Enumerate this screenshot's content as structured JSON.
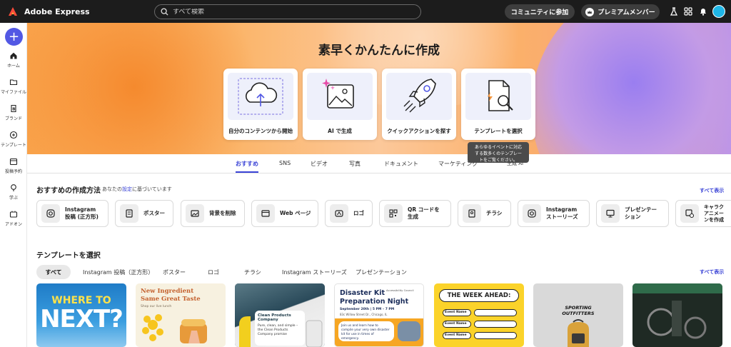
{
  "topbar": {
    "app_title": "Adobe Express",
    "search_placeholder": "すべて検索",
    "community_label": "コミュニティに参加",
    "premium_label": "プレミアムメンバー"
  },
  "sidebar": {
    "items": [
      {
        "label": "ホーム",
        "icon": "home-icon"
      },
      {
        "label": "マイファイル",
        "icon": "folder-icon"
      },
      {
        "label": "ブランド",
        "icon": "brand-icon"
      },
      {
        "label": "テンプレート",
        "icon": "template-icon"
      },
      {
        "label": "投稿予約",
        "icon": "calendar-icon"
      },
      {
        "label": "学ぶ",
        "icon": "learn-icon"
      },
      {
        "label": "アドオン",
        "icon": "addon-icon"
      }
    ]
  },
  "hero": {
    "title": "素早くかんたんに作成",
    "cards": [
      {
        "label": "自分のコンテンツから開始",
        "icon": "upload-cloud-icon"
      },
      {
        "label": "AI で生成",
        "icon": "ai-image-icon"
      },
      {
        "label": "クイックアクションを探す",
        "icon": "rocket-icon"
      },
      {
        "label": "テンプレートを選択",
        "icon": "template-search-icon"
      }
    ],
    "tooltip_line1": "あらゆるイベントに対応",
    "tooltip_line2": "する数多くのテンプレー",
    "tooltip_line3": "トをご覧ください。"
  },
  "tabs": {
    "items": [
      "おすすめ",
      "SNS",
      "ビデオ",
      "写真",
      "ドキュメント",
      "マーケティング"
    ],
    "extra": "生成 AI"
  },
  "recommended": {
    "title": "おすすめの作成方法",
    "subtitle_prefix": "あなたの",
    "subtitle_link": "設定",
    "subtitle_suffix": "に基づいています",
    "see_all": "すべて表示",
    "chips": [
      {
        "label": "Instagram\n投稿 (正方形)",
        "icon": "instagram-icon"
      },
      {
        "label": "ポスター",
        "icon": "poster-icon"
      },
      {
        "label": "背景を削除",
        "icon": "remove-bg-icon"
      },
      {
        "label": "Web ページ",
        "icon": "webpage-icon"
      },
      {
        "label": "ロゴ",
        "icon": "logo-icon"
      },
      {
        "label": "QR コードを\n生成",
        "icon": "qr-icon"
      },
      {
        "label": "チラシ",
        "icon": "flyer-icon"
      },
      {
        "label": "Instagram\nストーリーズ",
        "icon": "instagram-icon"
      },
      {
        "label": "プレゼンテー\nション",
        "icon": "presentation-icon"
      },
      {
        "label": "キャラク\nアニメー\nンを作成",
        "icon": "animate-icon"
      }
    ]
  },
  "templates": {
    "title": "テンプレートを選択",
    "see_all": "すべて表示",
    "filters": [
      "すべて",
      "Instagram 投稿（正方形）",
      "ポスター",
      "ロゴ",
      "チラシ",
      "Instagram ストーリーズ",
      "プレゼンテーション"
    ],
    "cards": {
      "t1_line1": "WHERE TO",
      "t1_line2": "NEXT?",
      "t2_title1": "New Ingredient",
      "t2_title2": "Same Great Taste",
      "t2_small": "Shop our live lunch",
      "t3_brand1": "Clean Products",
      "t3_brand2": "Company",
      "t3_body": "Pure, clean, and simple – the Clean Products Company promise",
      "t4_org": "Accessibility Council",
      "t4_title1": "Disaster Kit",
      "t4_title2": "Preparation Night",
      "t4_date": "September 20th | 5 PM – 7 PM",
      "t4_addr": "83c Willow Street Dr., Chicago, IL",
      "t4_band": "Join us and learn how to compile your very own disaster kit for use in times of emergency.",
      "t5_title": "THE WEEK AHEAD:",
      "t5_row": "Event Name",
      "t6_brand1": "SPORTING",
      "t6_brand2": "OUTFITTERS"
    }
  }
}
